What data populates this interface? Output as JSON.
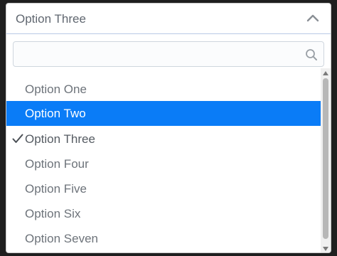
{
  "dropdown": {
    "selected_value": "Option Three",
    "search": {
      "value": "",
      "placeholder": ""
    },
    "options": [
      {
        "label": "Option One"
      },
      {
        "label": "Option Two"
      },
      {
        "label": "Option Three"
      },
      {
        "label": "Option Four"
      },
      {
        "label": "Option Five"
      },
      {
        "label": "Option Six"
      },
      {
        "label": "Option Seven"
      }
    ],
    "hovered_index": 1,
    "selected_index": 2
  },
  "icons": {
    "collapse": "chevron-up-icon",
    "search": "search-icon",
    "selected": "check-icon"
  },
  "colors": {
    "highlight": "#0a7cf7",
    "highlight_text": "#ffffff",
    "text": "#6d737a",
    "border_accent": "#b9c9e6"
  }
}
